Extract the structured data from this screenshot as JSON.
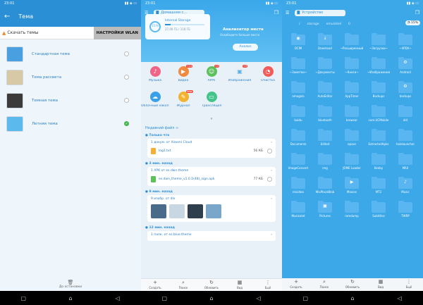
{
  "status": {
    "time": "23:01"
  },
  "panel1": {
    "title": "Тема",
    "skip_label": "Скачать темы",
    "wlan_label": "НАСТРОЙКИ WLAN",
    "themes": [
      {
        "name": "Стандартная тема",
        "selected": false,
        "color": "#4a9fe0"
      },
      {
        "name": "Тема рассвета",
        "selected": false,
        "color": "#d8c9a6"
      },
      {
        "name": "Темная тема",
        "selected": false,
        "color": "#3b3b3b"
      },
      {
        "name": "Летняя тема",
        "selected": true,
        "color": "#5cb9ee"
      }
    ],
    "bottom_label": "До остановки"
  },
  "panel2": {
    "location": "Домашняя с...",
    "storage_name": "Internal Storage",
    "storage_percent": "15%",
    "storage_fill": 0.15,
    "storage_size": "27,09 ГБ / 118 ГБ",
    "analyzer_title": "Анализатор места",
    "analyzer_sub": "Освободите больше места",
    "analyze_btn": "Анализ",
    "categories": [
      {
        "label": "Музыка",
        "icon": "♪",
        "color": "#f06587",
        "badge": ""
      },
      {
        "label": "Видео",
        "icon": "▶",
        "color": "#f08a3e",
        "badge": "+11"
      },
      {
        "label": "APPs",
        "icon": "☺",
        "color": "#5cc05c",
        "badge": "+3"
      },
      {
        "label": "Изображения",
        "icon": "▣",
        "color": "#eaeff3",
        "badge": "+9"
      },
      {
        "label": "Очистка",
        "icon": "◔",
        "color": "#f35a5a",
        "badge": ""
      },
      {
        "label": "Облачный накоп...",
        "icon": "☁",
        "color": "#3aa0e8",
        "badge": ""
      },
      {
        "label": "Журнал",
        "icon": "✎",
        "color": "#f0b430",
        "badge": "New"
      },
      {
        "label": "Трансляция",
        "icon": "▭",
        "color": "#43c48b",
        "badge": ""
      }
    ],
    "recent_title": "Недавний файл",
    "groups": [
      {
        "label": "Только что",
        "card_head": "1 докум. от Xiaomi Cloud",
        "file": "log1.txt",
        "size": "56 КБ",
        "file_color": "#f2b136"
      },
      {
        "label": "3 мин. назад",
        "card_head": "1 APK от es.dwn.theme",
        "file": "es.dwn_theme_v1.0.1(48)_sign.apk",
        "size": "77 КБ",
        "file_color": "#5cc05c"
      },
      {
        "label": "9 мин. назад",
        "card_head": "9 изобр. от dlx",
        "thumbs": [
          "#4a6a8a",
          "#c9d7e3",
          "#2f3e4c",
          "#7aa7c9"
        ]
      },
      {
        "label": "12 мин. назад",
        "card_head": "1 папк. от es.blue.theme"
      }
    ]
  },
  "tabs": [
    {
      "label": "Создать",
      "icon": "+"
    },
    {
      "label": "Поиск",
      "icon": "⌕"
    },
    {
      "label": "Обновить",
      "icon": "↻"
    },
    {
      "label": "Вид",
      "icon": "▦"
    },
    {
      "label": "Ещё",
      "icon": "⋮"
    }
  ],
  "panel3": {
    "location": "Устройство",
    "crumbs": [
      "/",
      "storage",
      "emulated",
      "0"
    ],
    "disk_percent": "15%",
    "folders": [
      {
        "name": "DCIM",
        "sym": "◉"
      },
      {
        "name": "Download",
        "sym": "↓"
      },
      {
        "name": "~Расширенный",
        "sym": ""
      },
      {
        "name": "~Загрузки~",
        "sym": ""
      },
      {
        "name": "~4PDA~",
        "sym": ""
      },
      {
        "name": "~Заметки~",
        "sym": ""
      },
      {
        "name": "~Документы",
        "sym": ""
      },
      {
        "name": "~Книги~",
        "sym": ""
      },
      {
        "name": "~Изображения",
        "sym": ""
      },
      {
        "name": "Android",
        "sym": "⚙"
      },
      {
        "name": "amogolo",
        "sym": ""
      },
      {
        "name": "AutoEditor",
        "sym": ""
      },
      {
        "name": "AppTimer",
        "sym": ""
      },
      {
        "name": "Backups",
        "sym": ""
      },
      {
        "name": "backups",
        "sym": "⚙"
      },
      {
        "name": "baidu",
        "sym": ""
      },
      {
        "name": "bluetooth",
        "sym": ""
      },
      {
        "name": "browser",
        "sym": ""
      },
      {
        "name": "com.UCMobile",
        "sym": ""
      },
      {
        "name": "did",
        "sym": ""
      },
      {
        "name": "Documents",
        "sym": ""
      },
      {
        "name": "Edited",
        "sym": ""
      },
      {
        "name": "epsxe",
        "sym": ""
      },
      {
        "name": "ExtractedApks",
        "sym": ""
      },
      {
        "name": "hololauncher",
        "sym": ""
      },
      {
        "name": "ImageConvert",
        "sym": ""
      },
      {
        "name": "img",
        "sym": ""
      },
      {
        "name": "JOME Loader",
        "sym": ""
      },
      {
        "name": "Keeby",
        "sym": ""
      },
      {
        "name": "MIUI",
        "sym": ""
      },
      {
        "name": "mivideo",
        "sym": ""
      },
      {
        "name": "MixPlaceBlob",
        "sym": ""
      },
      {
        "name": "Movies",
        "sym": "▶"
      },
      {
        "name": "MT2",
        "sym": ""
      },
      {
        "name": "Music",
        "sym": "♪"
      },
      {
        "name": "Musicolet",
        "sym": ""
      },
      {
        "name": "Pictures",
        "sym": "▣"
      },
      {
        "name": "ramdump",
        "sym": ""
      },
      {
        "name": "Subtitles",
        "sym": ""
      },
      {
        "name": "TWRP",
        "sym": ""
      }
    ]
  }
}
